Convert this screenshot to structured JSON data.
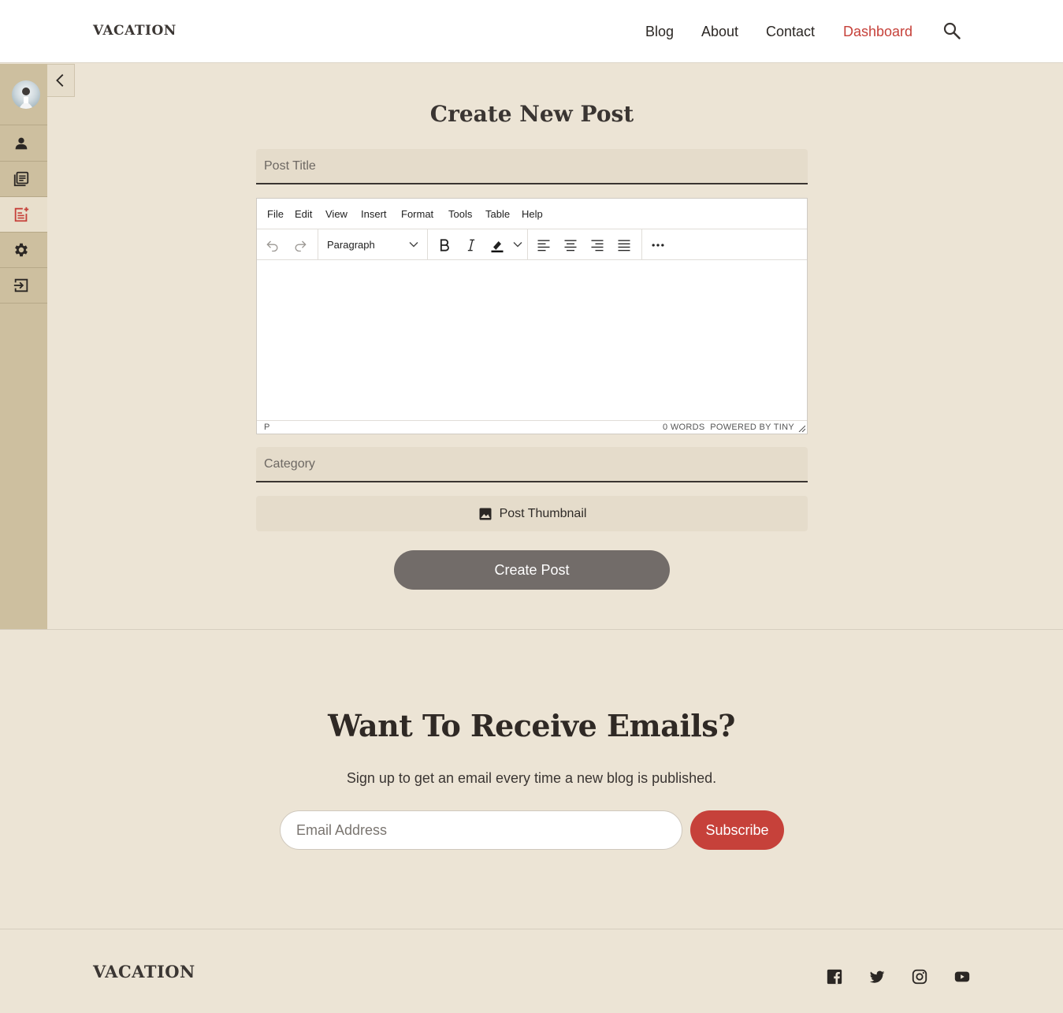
{
  "header": {
    "brand": "VACATION",
    "nav": [
      {
        "label": "Blog"
      },
      {
        "label": "About"
      },
      {
        "label": "Contact"
      },
      {
        "label": "Dashboard",
        "active": true
      }
    ],
    "search_icon": "search-icon"
  },
  "sidebar": {
    "items": [
      {
        "icon": "user-icon"
      },
      {
        "icon": "posts-icon"
      },
      {
        "icon": "new-post-icon",
        "active": true
      },
      {
        "icon": "gear-icon"
      },
      {
        "icon": "logout-icon"
      }
    ],
    "collapse_icon": "chevron-left-icon"
  },
  "form": {
    "title": "Create New Post",
    "post_title_placeholder": "Post Title",
    "category_placeholder": "Category",
    "thumbnail_label": "Post Thumbnail",
    "submit_label": "Create Post"
  },
  "editor": {
    "menus": [
      "File",
      "Edit",
      "View",
      "Insert",
      "Format",
      "Tools",
      "Table",
      "Help"
    ],
    "block_format": "Paragraph",
    "status_path": "P",
    "word_count": "0 WORDS",
    "powered_by": "POWERED BY TINY"
  },
  "newsletter": {
    "title": "Want To Receive Emails?",
    "subtitle": "Sign up to get an email every time a new blog is published.",
    "email_placeholder": "Email Address",
    "subscribe_label": "Subscribe"
  },
  "footer": {
    "brand": "VACATION",
    "social": [
      "facebook-icon",
      "twitter-icon",
      "instagram-icon",
      "youtube-icon"
    ]
  },
  "colors": {
    "accent": "#c6413a",
    "background": "#ece4d5",
    "sidebar": "#cdbf9f",
    "button": "#726c69"
  }
}
